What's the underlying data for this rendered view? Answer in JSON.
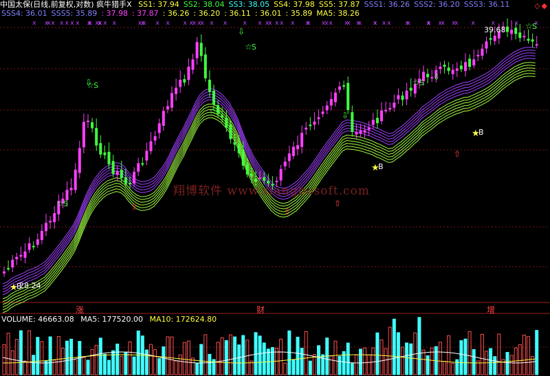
{
  "header": {
    "instrument": "中国太保(日线,前复权,对数)",
    "indicator": "疯牛猎手X",
    "line1": [
      {
        "label": "SS1: 37.94",
        "color": "#ffff40"
      },
      {
        "label": "SS2: 38.04",
        "color": "#40ff40"
      },
      {
        "label": "SS3: 38.05",
        "color": "#40ffff"
      },
      {
        "label": "SS4: 37.98",
        "color": "#ffff40"
      },
      {
        "label": "SS5: 37.87",
        "color": "#ffff40"
      },
      {
        "label": "SSS1: 36.26",
        "color": "#8080ff"
      },
      {
        "label": "SSS2: 36.20",
        "color": "#8080ff"
      },
      {
        "label": "SSS3: 36.11",
        "color": "#8080ff"
      }
    ],
    "line2": [
      {
        "label": "SSS4: 36.01",
        "color": "#8080ff"
      },
      {
        "label": "SSS5: 35.89",
        "color": "#8080ff"
      },
      {
        "label": ": 37.98",
        "color": "#ff40ff"
      },
      {
        "label": ": 37.87",
        "color": "#ff40ff"
      },
      {
        "label": ": 36.26",
        "color": "#ffff40"
      },
      {
        "label": ": 36.20",
        "color": "#ffff40"
      },
      {
        "label": ": 36.11",
        "color": "#ffff40"
      },
      {
        "label": ": 36.01",
        "color": "#ffff40"
      },
      {
        "label": ": 35.89",
        "color": "#ffff40"
      },
      {
        "label": "MA5: 38.26",
        "color": "#ffff40"
      }
    ],
    "nav_glyphs": "◇◆"
  },
  "annotations": {
    "high_value": "39.68",
    "low_value": "28.24",
    "buy_marker": "B",
    "sell_marker": "S",
    "event1": "涨",
    "event2": "财",
    "event3": "增"
  },
  "watermark": "翔博软件 www.xiangbosoft.com",
  "volume": {
    "label": "VOLUME: 46663.08",
    "ma5": "MA5: 177520.00",
    "ma10": "MA10: 172624.80",
    "label_color": "#ffffff",
    "ma5_color": "#ffffff",
    "ma10_color": "#ffff40"
  },
  "colors": {
    "up": "#ff40ff",
    "down": "#40ff40",
    "flat": "#ffff40",
    "grid": "#7a1a1a",
    "ribbon_purple": "#a040ff",
    "ribbon_green": "#a0ff40"
  }
}
